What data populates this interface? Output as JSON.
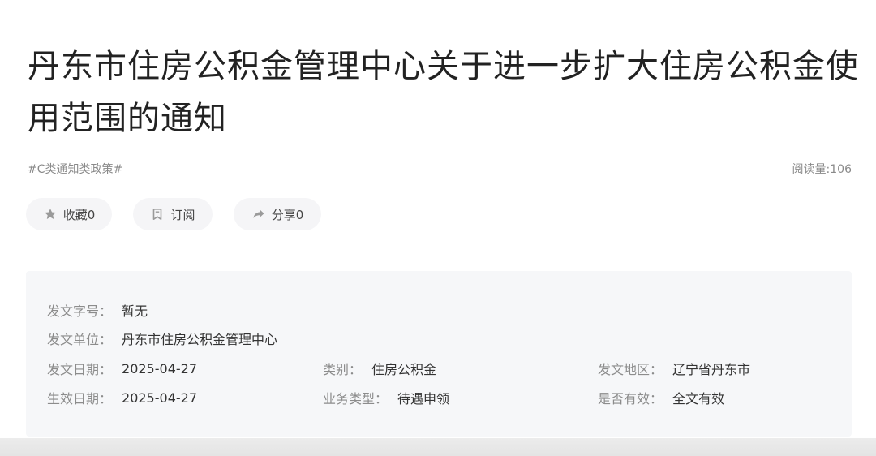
{
  "article": {
    "title": "丹东市住房公积金管理中心关于进一步扩大住房公积金使用范围的通知",
    "tag": "#C类通知类政策#",
    "read_count": "阅读量:106"
  },
  "actions": {
    "favorite": "收藏0",
    "subscribe": "订阅",
    "share": "分享0"
  },
  "info": {
    "doc_number": {
      "label": "发文字号：",
      "value": "暂无"
    },
    "issuer": {
      "label": "发文单位：",
      "value": "丹东市住房公积金管理中心"
    },
    "issue_date": {
      "label": "发文日期：",
      "value": "2025-04-27"
    },
    "category": {
      "label": "类别：",
      "value": "住房公积金"
    },
    "region": {
      "label": "发文地区：",
      "value": "辽宁省丹东市"
    },
    "effective_date": {
      "label": "生效日期：",
      "value": "2025-04-27"
    },
    "business_type": {
      "label": "业务类型：",
      "value": "待遇申领"
    },
    "validity": {
      "label": "是否有效：",
      "value": "全文有效"
    }
  },
  "icons": {
    "favorite": "star-icon",
    "subscribe": "bookmark-icon",
    "share": "share-arrow-icon"
  },
  "colors": {
    "title": "#222222",
    "muted": "#8a8a8a",
    "button_bg": "#f5f5f7",
    "info_bg": "#f6f7f9"
  }
}
